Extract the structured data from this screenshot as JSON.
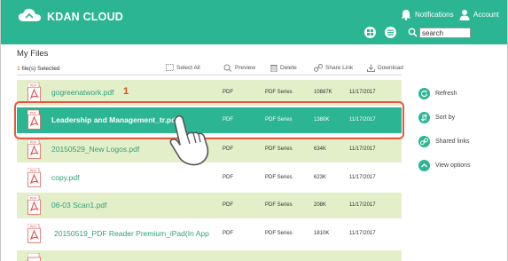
{
  "header": {
    "brand": "KDAN CLOUD",
    "notifications_label": "Notifications",
    "account_label": "Account",
    "search_value": "search"
  },
  "files": {
    "title": "My Files",
    "selected_count": "1",
    "selected_suffix": " file(s) Selected",
    "toolbar": {
      "select_all": "Select All",
      "preview": "Preview",
      "delete": "Delete",
      "share_link": "Share Link",
      "download": "Download"
    },
    "rows": [
      {
        "name": "gogreenatwork.pdf",
        "type": "PDF",
        "series": "PDF Series",
        "size": "10887K",
        "date": "11/17/2017"
      },
      {
        "name": "Leadership and Management_tr.pdf",
        "type": "PDF",
        "series": "PDF Series",
        "size": "1380K",
        "date": "11/17/2017"
      },
      {
        "name": "20150529_New Logos.pdf",
        "type": "PDF",
        "series": "PDF Series",
        "size": "634K",
        "date": "11/17/2017"
      },
      {
        "name": "copy.pdf",
        "type": "PDF",
        "series": "PDF Series",
        "size": "623K",
        "date": "11/17/2017"
      },
      {
        "name": "06-03 Scan1.pdf",
        "type": "PDF",
        "series": "PDF Series",
        "size": "208K",
        "date": "11/17/2017"
      },
      {
        "name": "20150519_PDF Reader Premium_iPad(In App",
        "type": "PDF",
        "series": "PDF Series",
        "size": "1810K",
        "date": "11/17/2017"
      }
    ]
  },
  "annotation": {
    "step_number": "1"
  },
  "sidebar": {
    "refresh": "Refresh",
    "sort_by": "Sort by",
    "shared_links": "Shared links",
    "view_options": "View options"
  },
  "colors": {
    "brand_green": "#2bb592",
    "row_alt": "#e3efc9",
    "highlight": "#e8573f"
  },
  "icons": [
    "cloud-logo-icon",
    "bell-icon",
    "user-icon",
    "grid-view-icon",
    "list-view-icon",
    "search-icon",
    "checkbox-icon",
    "preview-icon",
    "trash-icon",
    "link-icon",
    "download-icon",
    "pdf-file-icon",
    "hand-pointer-icon",
    "refresh-icon",
    "sort-icon",
    "share-icon",
    "chevron-up-icon"
  ]
}
